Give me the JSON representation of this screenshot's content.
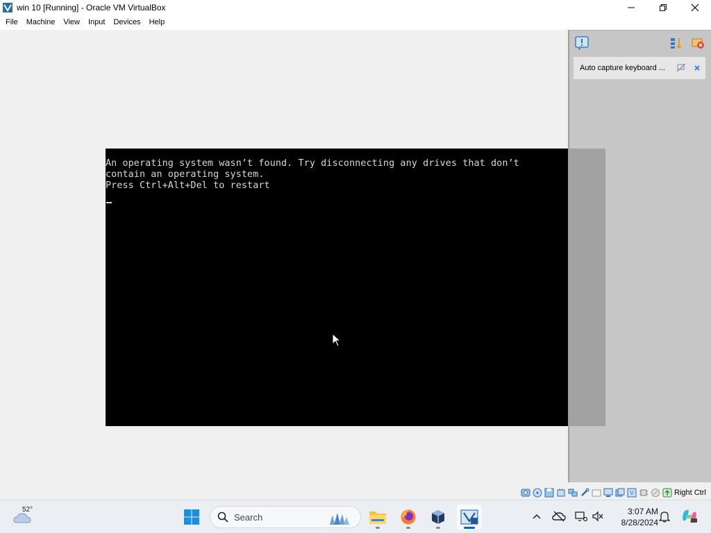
{
  "window": {
    "title": "win 10 [Running] - Oracle VM VirtualBox"
  },
  "menu": [
    "File",
    "Machine",
    "View",
    "Input",
    "Devices",
    "Help"
  ],
  "console": {
    "lines": [
      "An operating system wasn’t found. Try disconnecting any drives that don’t",
      "contain an operating system.",
      "Press Ctrl+Alt+Del to restart"
    ]
  },
  "notification_panel": {
    "message": "Auto capture keyboard ..."
  },
  "statusbar": {
    "icons": [
      "hard-disk-icon",
      "optical-drive-icon",
      "floppy-icon",
      "audio-icon",
      "network-icon",
      "usb-icon",
      "shared-folders-icon",
      "display-icon",
      "video-capture-icon",
      "virtualization-icon",
      "cpu-icon",
      "mouse-integration-icon",
      "keyboard-icon"
    ],
    "host_key": "Right Ctrl"
  },
  "taskbar": {
    "weather_temp": "52°",
    "search_label": "Search",
    "time": "3:07 AM",
    "date": "8/28/2024"
  }
}
